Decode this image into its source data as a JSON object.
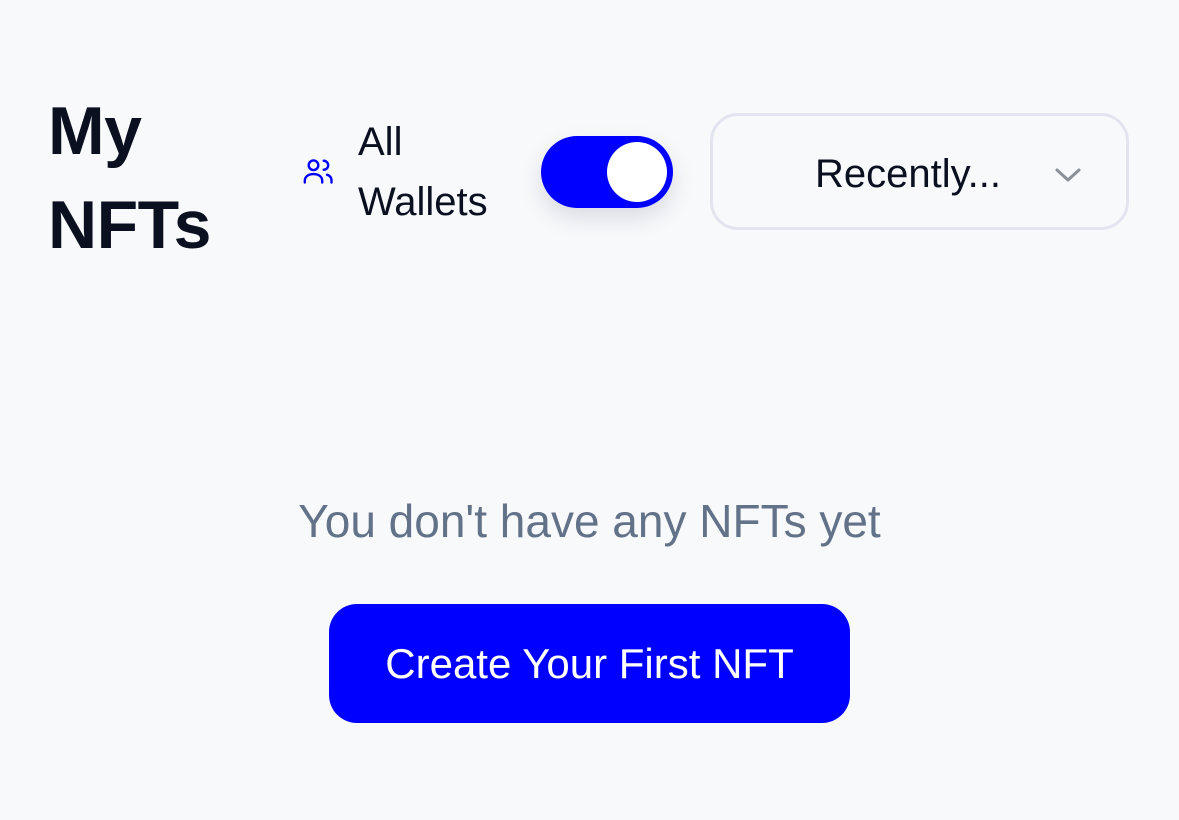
{
  "header": {
    "title": "My NFTs",
    "wallet_filter": {
      "icon": "users-icon",
      "label": "All Wallets",
      "enabled": true
    },
    "sort": {
      "selected": "Recently...",
      "icon": "chevron-down-icon"
    }
  },
  "empty_state": {
    "message": "You don't have any NFTs yet",
    "cta_label": "Create Your First NFT"
  },
  "colors": {
    "accent": "#0000FF",
    "background": "#F8F9FB",
    "muted_text": "#627288",
    "text": "#0B1020",
    "border": "#E2E5F0"
  }
}
